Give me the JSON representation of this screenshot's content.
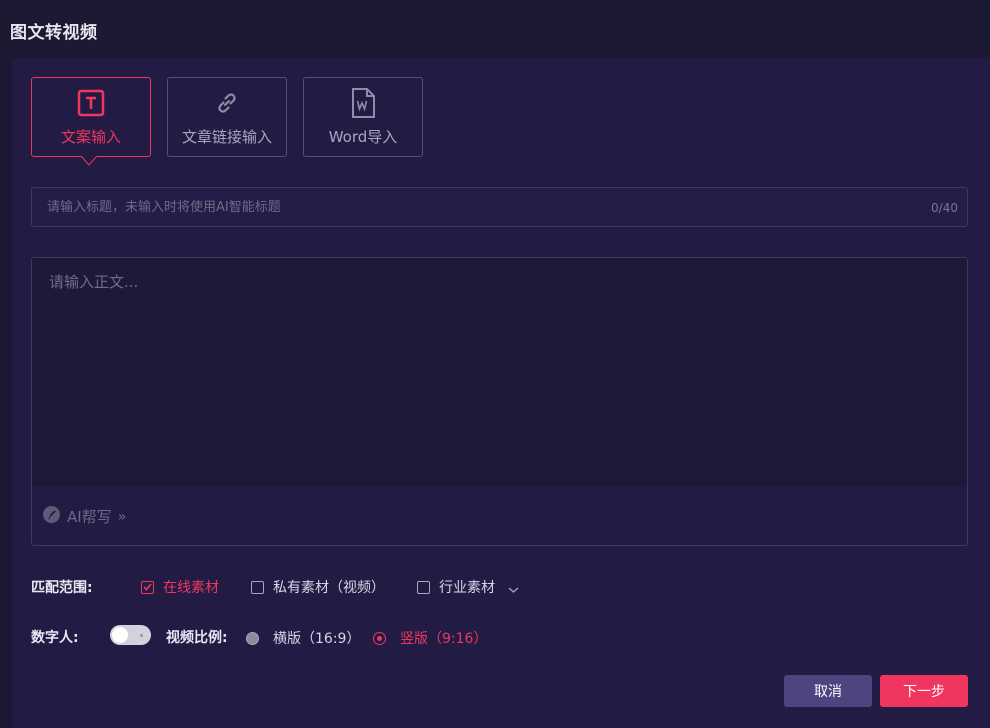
{
  "header": {
    "title": "图文转视频"
  },
  "source_tabs": [
    {
      "label": "文案输入",
      "icon": "text-t-icon",
      "active": true
    },
    {
      "label": "文章链接输入",
      "icon": "link-icon",
      "active": false
    },
    {
      "label": "Word导入",
      "icon": "word-file-icon",
      "active": false
    }
  ],
  "title_field": {
    "placeholder": "请输入标题，未输入时将使用AI智能标题",
    "value": "",
    "char_count": "0/40"
  },
  "body_field": {
    "placeholder": "请输入正文...",
    "value": ""
  },
  "ai_write": {
    "label": "AI帮写",
    "arrow": "»"
  },
  "match_scope": {
    "label": "匹配范围:",
    "options": [
      {
        "label": "在线素材",
        "checked": true
      },
      {
        "label": "私有素材（视频）",
        "checked": false
      },
      {
        "label": "行业素材",
        "checked": false
      }
    ]
  },
  "digital_human": {
    "label": "数字人:",
    "enabled": false
  },
  "video_ratio": {
    "label": "视频比例:",
    "options": [
      {
        "label": "横版（16:9）",
        "checked": false
      },
      {
        "label": "竖版（9:16）",
        "checked": true
      }
    ]
  },
  "footer": {
    "cancel_label": "取消",
    "next_label": "下一步"
  },
  "colors": {
    "accent": "#f0365e",
    "background": "#1c1834",
    "panel": "#221c45",
    "cancel_button": "#4c4580"
  }
}
